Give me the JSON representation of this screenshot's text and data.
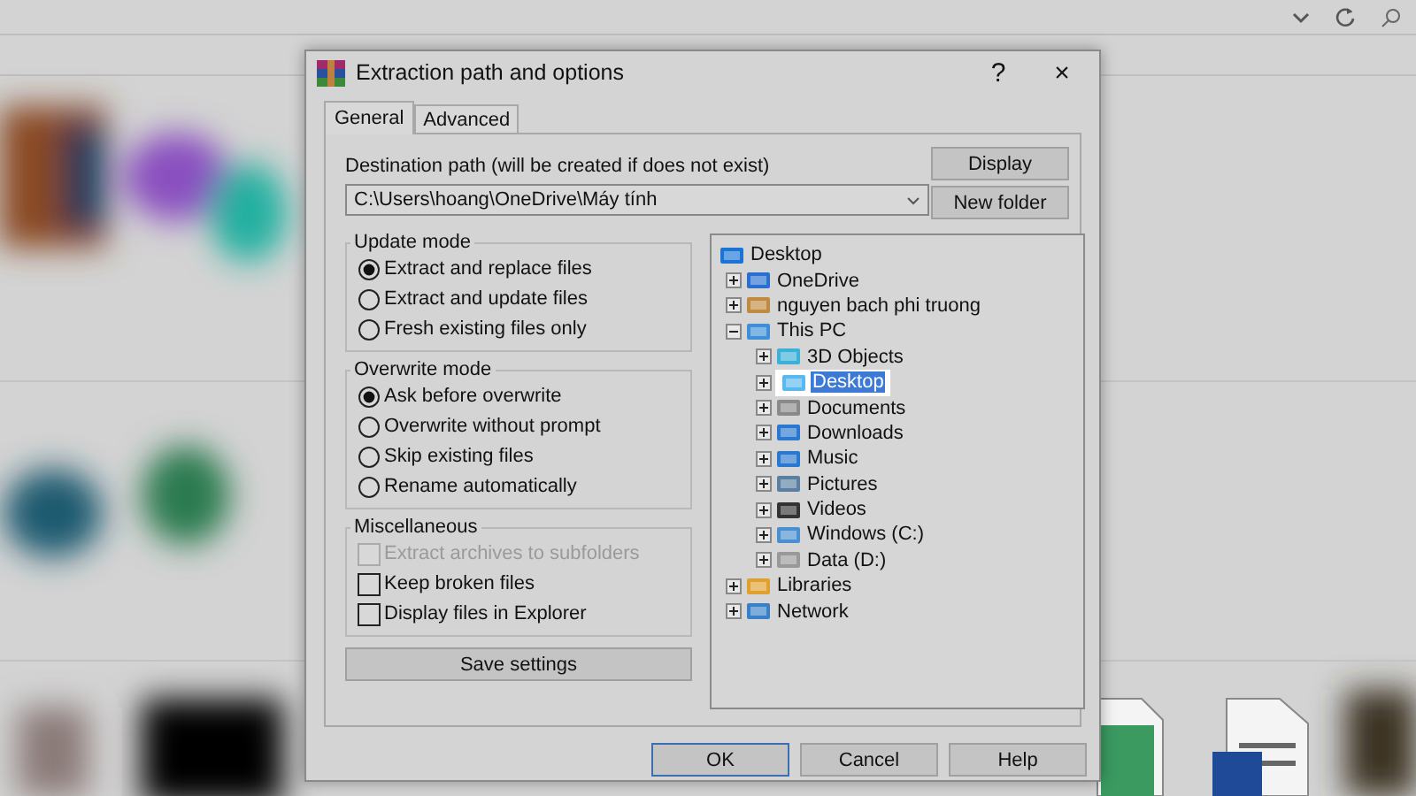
{
  "window": {
    "title": "Extraction path and options",
    "help": "?",
    "close": "×"
  },
  "tabs": [
    {
      "label": "General",
      "selected": true
    },
    {
      "label": "Advanced",
      "selected": false
    }
  ],
  "destination": {
    "label": "Destination path (will be created if does not exist)",
    "value": "C:\\Users\\hoang\\OneDrive\\Máy tính"
  },
  "side_buttons": [
    "Display",
    "New folder"
  ],
  "update_mode": {
    "title": "Update mode",
    "options": [
      {
        "label": "Extract and replace files",
        "selected": true
      },
      {
        "label": "Extract and update files",
        "selected": false
      },
      {
        "label": "Fresh existing files only",
        "selected": false
      }
    ]
  },
  "overwrite_mode": {
    "title": "Overwrite mode",
    "options": [
      {
        "label": "Ask before overwrite",
        "selected": true
      },
      {
        "label": "Overwrite without prompt",
        "selected": false
      },
      {
        "label": "Skip existing files",
        "selected": false
      },
      {
        "label": "Rename automatically",
        "selected": false
      }
    ]
  },
  "miscellaneous": {
    "title": "Miscellaneous",
    "options": [
      {
        "label": "Extract archives to subfolders",
        "checked": false,
        "disabled": true
      },
      {
        "label": "Keep broken files",
        "checked": false,
        "disabled": false
      },
      {
        "label": "Display files in Explorer",
        "checked": false,
        "disabled": false
      }
    ]
  },
  "save_button": "Save settings",
  "tree": [
    {
      "label": "Desktop",
      "selected": false,
      "children": [
        {
          "label": "OneDrive",
          "selected": false,
          "expanded": false
        },
        {
          "label": "nguyen bach phi truong",
          "selected": false,
          "expanded": false
        },
        {
          "label": "This PC",
          "selected": false,
          "expanded": true,
          "children": [
            {
              "label": "3D Objects",
              "selected": false,
              "expanded": false
            },
            {
              "label": "Desktop",
              "selected": true,
              "expanded": false
            },
            {
              "label": "Documents",
              "selected": false,
              "expanded": false
            },
            {
              "label": "Downloads",
              "selected": false,
              "expanded": false
            },
            {
              "label": "Music",
              "selected": false,
              "expanded": false
            },
            {
              "label": "Pictures",
              "selected": false,
              "expanded": false
            },
            {
              "label": "Videos",
              "selected": false,
              "expanded": false
            },
            {
              "label": "Windows (C:)",
              "selected": false,
              "expanded": false
            },
            {
              "label": "Data (D:)",
              "selected": false,
              "expanded": false
            }
          ]
        },
        {
          "label": "Libraries",
          "selected": false,
          "expanded": false
        },
        {
          "label": "Network",
          "selected": false,
          "expanded": false
        }
      ]
    }
  ],
  "buttons": [
    {
      "label": "OK",
      "default": true
    },
    {
      "label": "Cancel",
      "default": false
    },
    {
      "label": "Help",
      "default": false
    }
  ]
}
